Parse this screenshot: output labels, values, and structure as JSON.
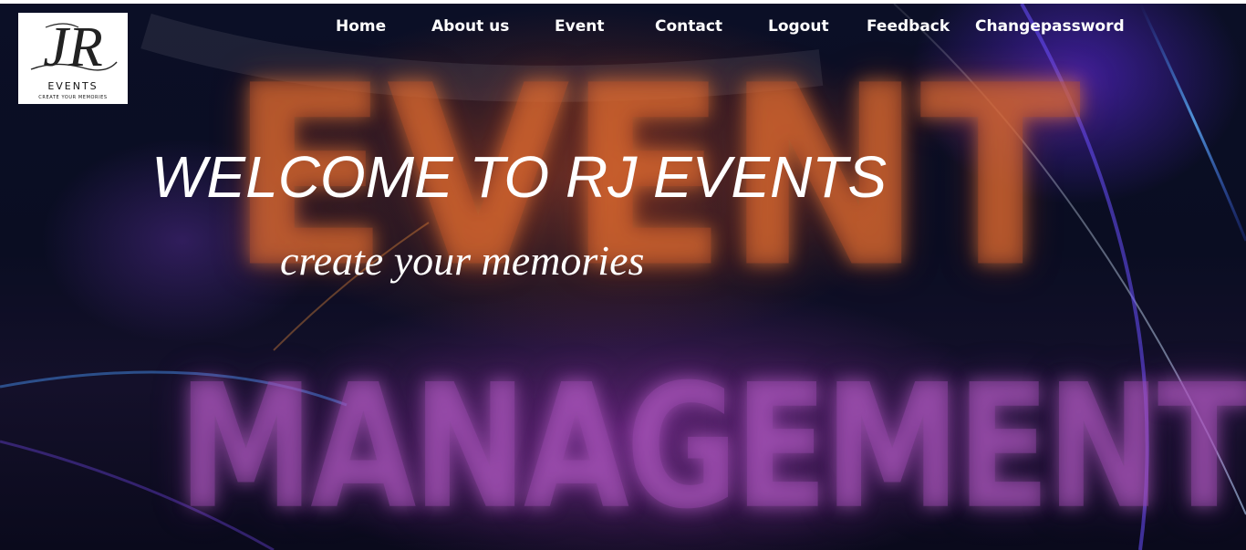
{
  "logo": {
    "monogram": "JR",
    "wordmark": "EVENTS",
    "tagline": "CREATE YOUR MEMORIES"
  },
  "nav": {
    "items": [
      {
        "label": "Home"
      },
      {
        "label": "About us"
      },
      {
        "label": "Event"
      },
      {
        "label": "Contact"
      },
      {
        "label": "Logout"
      },
      {
        "label": "Feedback"
      },
      {
        "label": "Changepassword"
      }
    ]
  },
  "hero": {
    "title": "WELCOME TO RJ EVENTS",
    "subtitle": "create your memories",
    "background_words": [
      "EVENT",
      "MANAGEMENT"
    ]
  },
  "colors": {
    "nav_text": "#ffffff",
    "hero_text": "#ffffff",
    "background_dark": "#0b0f26",
    "glow_orange": "#ff8c3c",
    "glow_purple": "#b060d0",
    "glow_blue": "#3a5cff"
  }
}
